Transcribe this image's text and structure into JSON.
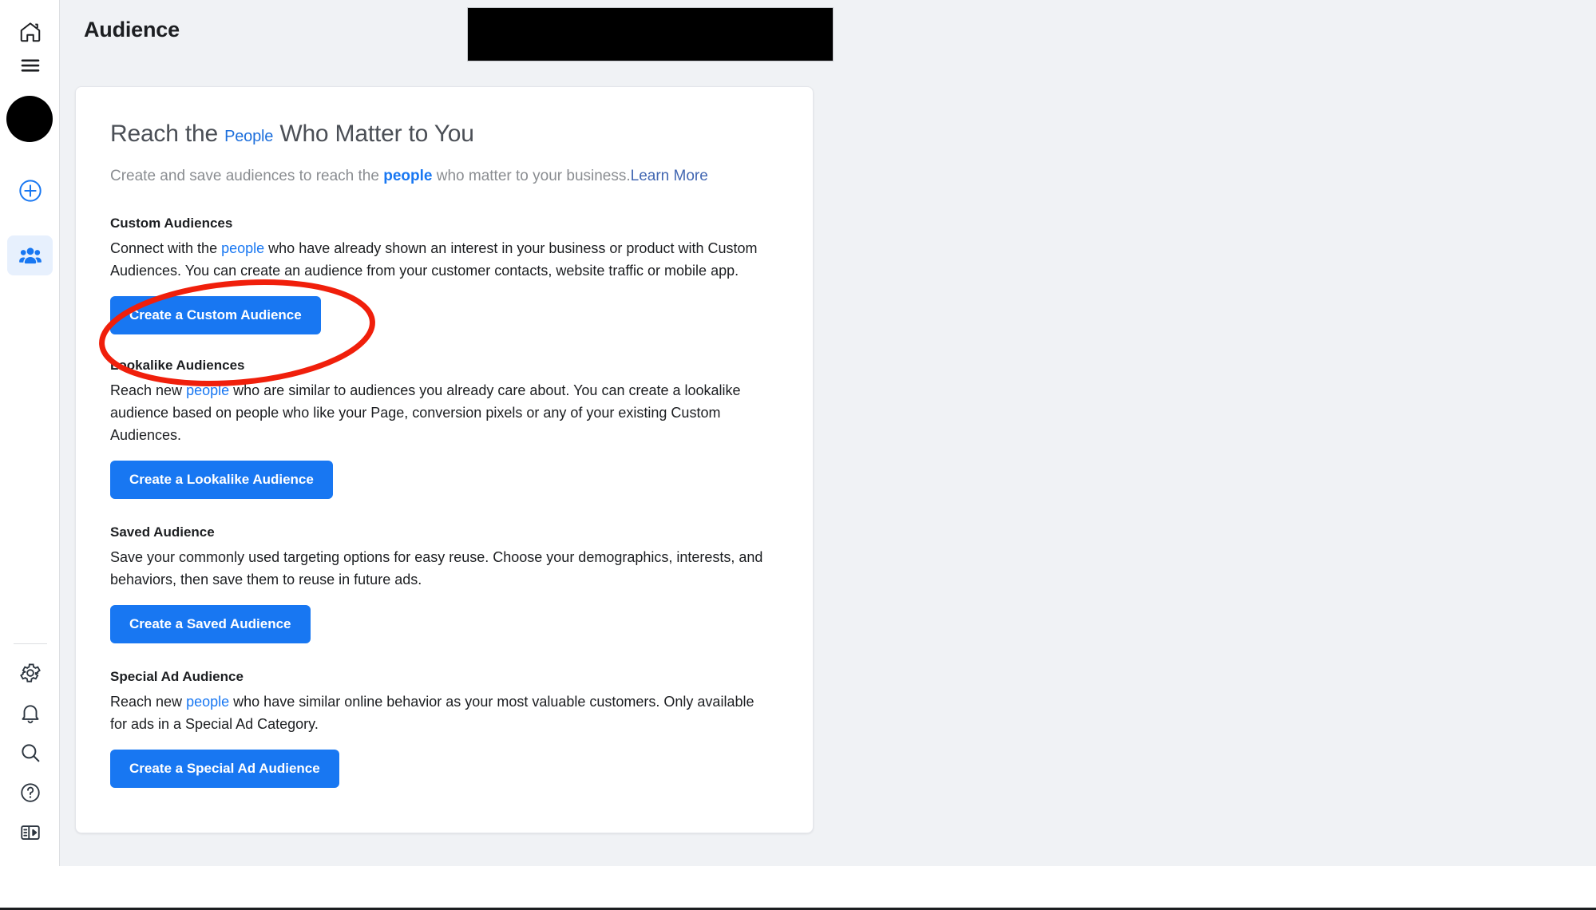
{
  "window": {
    "page_title": "Audience"
  },
  "sidebar": {
    "items": [
      {
        "name": "home-icon",
        "label": "Home"
      },
      {
        "name": "menu-icon",
        "label": "Menu"
      },
      {
        "name": "avatar",
        "label": "Account"
      },
      {
        "name": "create-icon",
        "label": "Create"
      },
      {
        "name": "audiences-icon",
        "label": "Audiences",
        "active": true
      }
    ],
    "bottom_items": [
      {
        "name": "gear-icon",
        "label": "Settings"
      },
      {
        "name": "bell-icon",
        "label": "Notifications"
      },
      {
        "name": "search-icon",
        "label": "Search"
      },
      {
        "name": "help-icon",
        "label": "Help"
      },
      {
        "name": "panel-toggle-icon",
        "label": "Toggle panel"
      }
    ]
  },
  "hero": {
    "title_part1": "Reach the",
    "title_people": "People",
    "title_part2": "Who Matter to You",
    "subtitle_part1": "Create and save audiences to reach the",
    "subtitle_people": "people",
    "subtitle_part2": "who matter to your business.",
    "learn_more": "Learn More"
  },
  "sections": [
    {
      "title": "Custom Audiences",
      "body_part1": "Connect with the",
      "body_people": "people",
      "body_part2": "who have already shown an interest in your business or product with Custom Audiences. You can create an audience from your customer contacts, website traffic or mobile app.",
      "button": "Create a Custom Audience"
    },
    {
      "title": "Lookalike Audiences",
      "body_part1": "Reach new",
      "body_people": "people",
      "body_part2": "who are similar to audiences you already care about. You can create a lookalike audience based on people who like your Page, conversion pixels or any of your existing Custom Audiences.",
      "button": "Create a Lookalike Audience"
    },
    {
      "title": "Saved Audience",
      "body_part1": "Save your commonly used targeting options for easy reuse. Choose your demographics, interests, and behaviors, then save them to reuse in future ads.",
      "body_people": "",
      "body_part2": "",
      "button": "Create a Saved Audience"
    },
    {
      "title": "Special Ad Audience",
      "body_part1": "Reach new",
      "body_people": "people",
      "body_part2": "who have similar online behavior as your most valuable customers. Only available for ads in a Special Ad Category.",
      "button": "Create a Special Ad Audience"
    }
  ],
  "annotation": {
    "type": "hand-drawn-ellipse",
    "color": "#f01f0b",
    "target": "Create a Custom Audience"
  },
  "colors": {
    "accent_blue": "#1877f2",
    "link_blue": "#4267b2",
    "page_background": "#f0f2f5",
    "card_background": "#ffffff",
    "text_primary": "#1c1e21",
    "text_muted": "#8a8d91",
    "annotation_red": "#f01f0b"
  }
}
